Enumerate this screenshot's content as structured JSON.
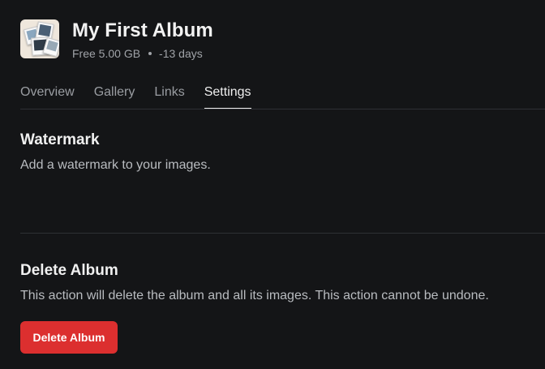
{
  "album": {
    "title": "My First Album",
    "storage": "Free 5.00 GB",
    "expiry": "-13 days",
    "thumbnail_icon": "album-photos-thumbnail"
  },
  "tabs": [
    {
      "label": "Overview",
      "active": false
    },
    {
      "label": "Gallery",
      "active": false
    },
    {
      "label": "Links",
      "active": false
    },
    {
      "label": "Settings",
      "active": true
    }
  ],
  "watermark": {
    "title": "Watermark",
    "description": "Add a watermark to your images."
  },
  "delete_album": {
    "title": "Delete Album",
    "description": "This action will delete the album and all its images. This action cannot be undone.",
    "button_label": "Delete Album"
  },
  "colors": {
    "background": "#141517",
    "danger": "#dc2f2f",
    "active_tab": "#f0f0f0",
    "inactive_tab": "#9a9da2"
  }
}
